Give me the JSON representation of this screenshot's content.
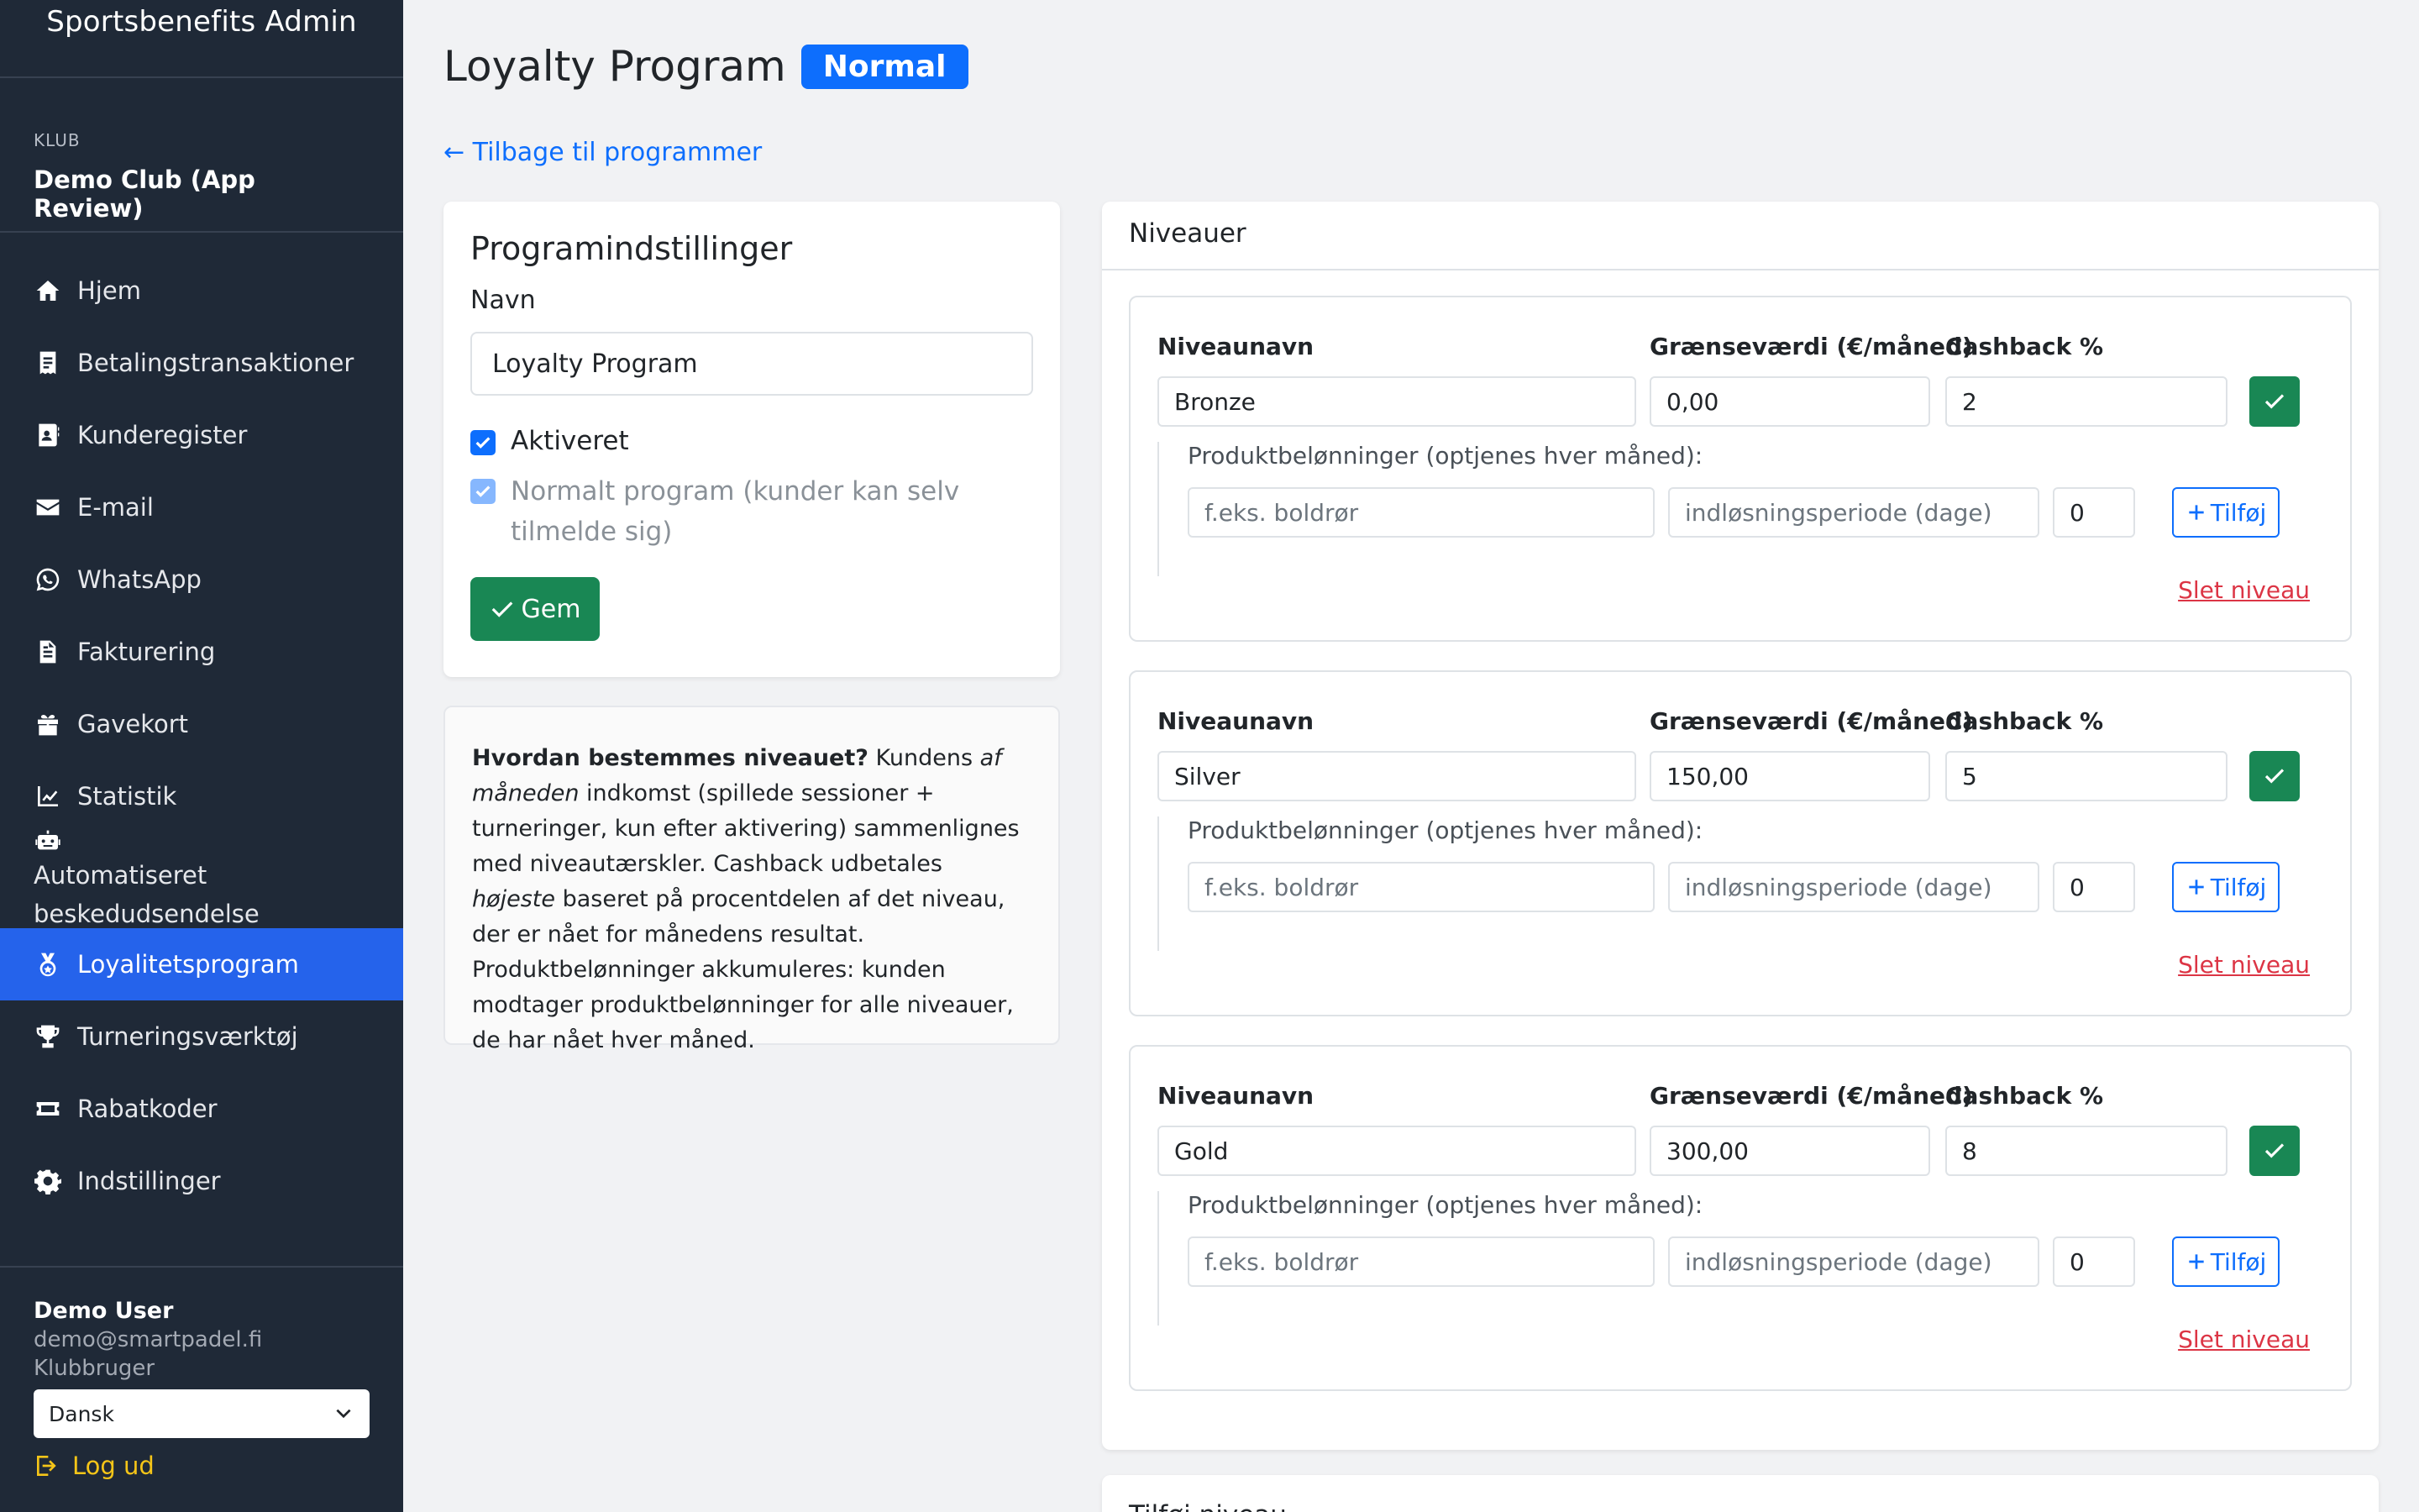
{
  "app": {
    "title": "Sportsbenefits Admin"
  },
  "club": {
    "caption": "KLUB",
    "name": "Demo Club (App Review)"
  },
  "nav": [
    {
      "label": "Hjem",
      "icon": "home-icon"
    },
    {
      "label": "Betalingstransaktioner",
      "icon": "receipt-icon"
    },
    {
      "label": "Kunderegister",
      "icon": "contact-card-icon"
    },
    {
      "label": "E-mail",
      "icon": "envelope-icon"
    },
    {
      "label": "WhatsApp",
      "icon": "whatsapp-icon"
    },
    {
      "label": "Fakturering",
      "icon": "invoice-icon"
    },
    {
      "label": "Gavekort",
      "icon": "gift-icon"
    },
    {
      "label": "Statistik",
      "icon": "chart-line-icon"
    },
    {
      "label": "Automatiseret beskedudsendelse",
      "icon": "robot-icon"
    },
    {
      "label": "Loyalitetsprogram",
      "icon": "medal-icon",
      "active": true
    },
    {
      "label": "Turneringsværktøj",
      "icon": "trophy-icon"
    },
    {
      "label": "Rabatkoder",
      "icon": "ticket-icon"
    },
    {
      "label": "Indstillinger",
      "icon": "gear-icon"
    }
  ],
  "user": {
    "name": "Demo User",
    "email": "demo@smartpadel.fi",
    "role": "Klubbruger",
    "language": "Dansk",
    "logout_label": "Log ud"
  },
  "page": {
    "title": "Loyalty Program",
    "badge": "Normal",
    "back_link": "← Tilbage til programmer"
  },
  "settings": {
    "title": "Programindstillinger",
    "name_label": "Navn",
    "name_value": "Loyalty Program",
    "enabled_label": "Aktiveret",
    "enabled": true,
    "normal_label": "Normalt program (kunder kan selv tilmelde sig)",
    "normal_checked": true,
    "save_label": "Gem"
  },
  "info": {
    "q": "Hvordan bestemmes niveauet?",
    "t1": " Kundens ",
    "em1": "af måneden",
    "t2": " indkomst (spillede sessioner + turneringer, kun efter aktivering) sammenlignes med niveautærskler. Cashback udbetales ",
    "em2": "højeste",
    "t3": " baseret på procentdelen af det niveau, der er nået for månedens resultat. Produktbelønninger akkumuleres: kunden modtager produktbelønninger for alle niveauer, de har nået hver måned."
  },
  "levels": {
    "title": "Niveauer",
    "name_label": "Niveaunavn",
    "threshold_label": "Grænseværdi (€/måned)",
    "cashback_label": "Cashback %",
    "rewards_label": "Produktbelønninger (optjenes hver måned):",
    "reward_placeholder": "f.eks. boldrør",
    "period_placeholder": "indløsningsperiode (dage)",
    "qty_default": "0",
    "add_label": "Tilføj",
    "delete_label": "Slet niveau",
    "items": [
      {
        "name": "Bronze",
        "threshold": "0,00",
        "cashback": "2"
      },
      {
        "name": "Silver",
        "threshold": "150,00",
        "cashback": "5"
      },
      {
        "name": "Gold",
        "threshold": "300,00",
        "cashback": "8"
      }
    ]
  },
  "next_card": {
    "title": "Tilføj niveau"
  },
  "colors": {
    "sidebar": "#1f2937",
    "accent": "#2563eb",
    "primary": "#0d6efd",
    "success": "#198754",
    "danger": "#dc3545"
  }
}
